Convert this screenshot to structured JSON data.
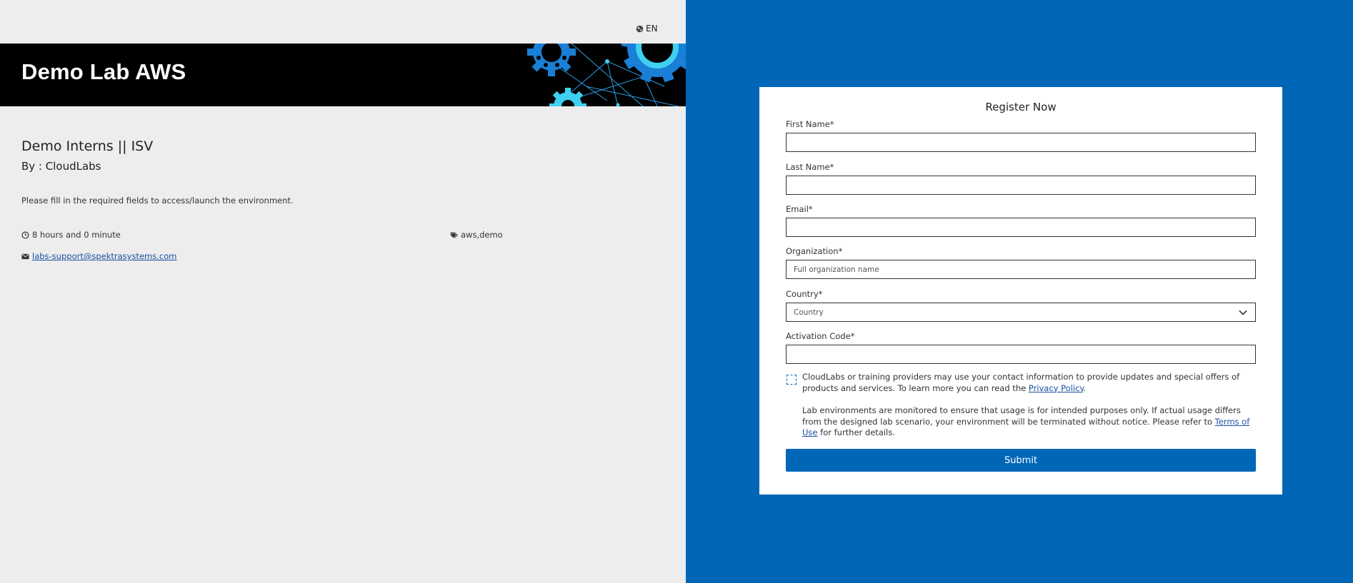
{
  "header": {
    "language": "EN",
    "banner_title": "Demo Lab AWS"
  },
  "course": {
    "title": "Demo Interns || ISV",
    "by": "By : CloudLabs",
    "description": "Please fill in the required fields to access/launch the environment.",
    "duration": "8 hours and 0 minute",
    "tags": "aws,demo",
    "support_email": " labs-support@spektrasystems.com"
  },
  "form": {
    "title": "Register Now",
    "first_name_label": "First Name*",
    "first_name_value": "",
    "last_name_label": "Last Name*",
    "last_name_value": "",
    "email_label": "Email*",
    "email_value": "",
    "organization_label": "Organization*",
    "organization_placeholder": "Full organization name",
    "country_label": "Country*",
    "country_selected": "Country",
    "activation_label": "Activation Code*",
    "activation_value": "",
    "consent_text_1": "CloudLabs or training providers may use your contact information to provide updates and special offers of products and services. To learn more you can read the ",
    "privacy_link": "Privacy Policy",
    "consent_text_1_end": ".",
    "monitor_text_1": "Lab environments are monitored to ensure that usage is for intended purposes only. If actual usage differs from the designed lab scenario, your environment will be terminated without notice. Please refer to ",
    "terms_link": "Terms of Use",
    "monitor_text_2": " for further details.",
    "submit_label": "Submit"
  },
  "colors": {
    "brand_blue": "#0067b8",
    "banner_bg": "#000000",
    "gear_blue": "#1a7fd6",
    "gear_cyan": "#3fd0f0"
  },
  "icons": {
    "language": "globe-icon",
    "duration": "clock-icon",
    "tags": "tag-icon",
    "support": "envelope-icon",
    "country": "chevron-down-icon"
  }
}
